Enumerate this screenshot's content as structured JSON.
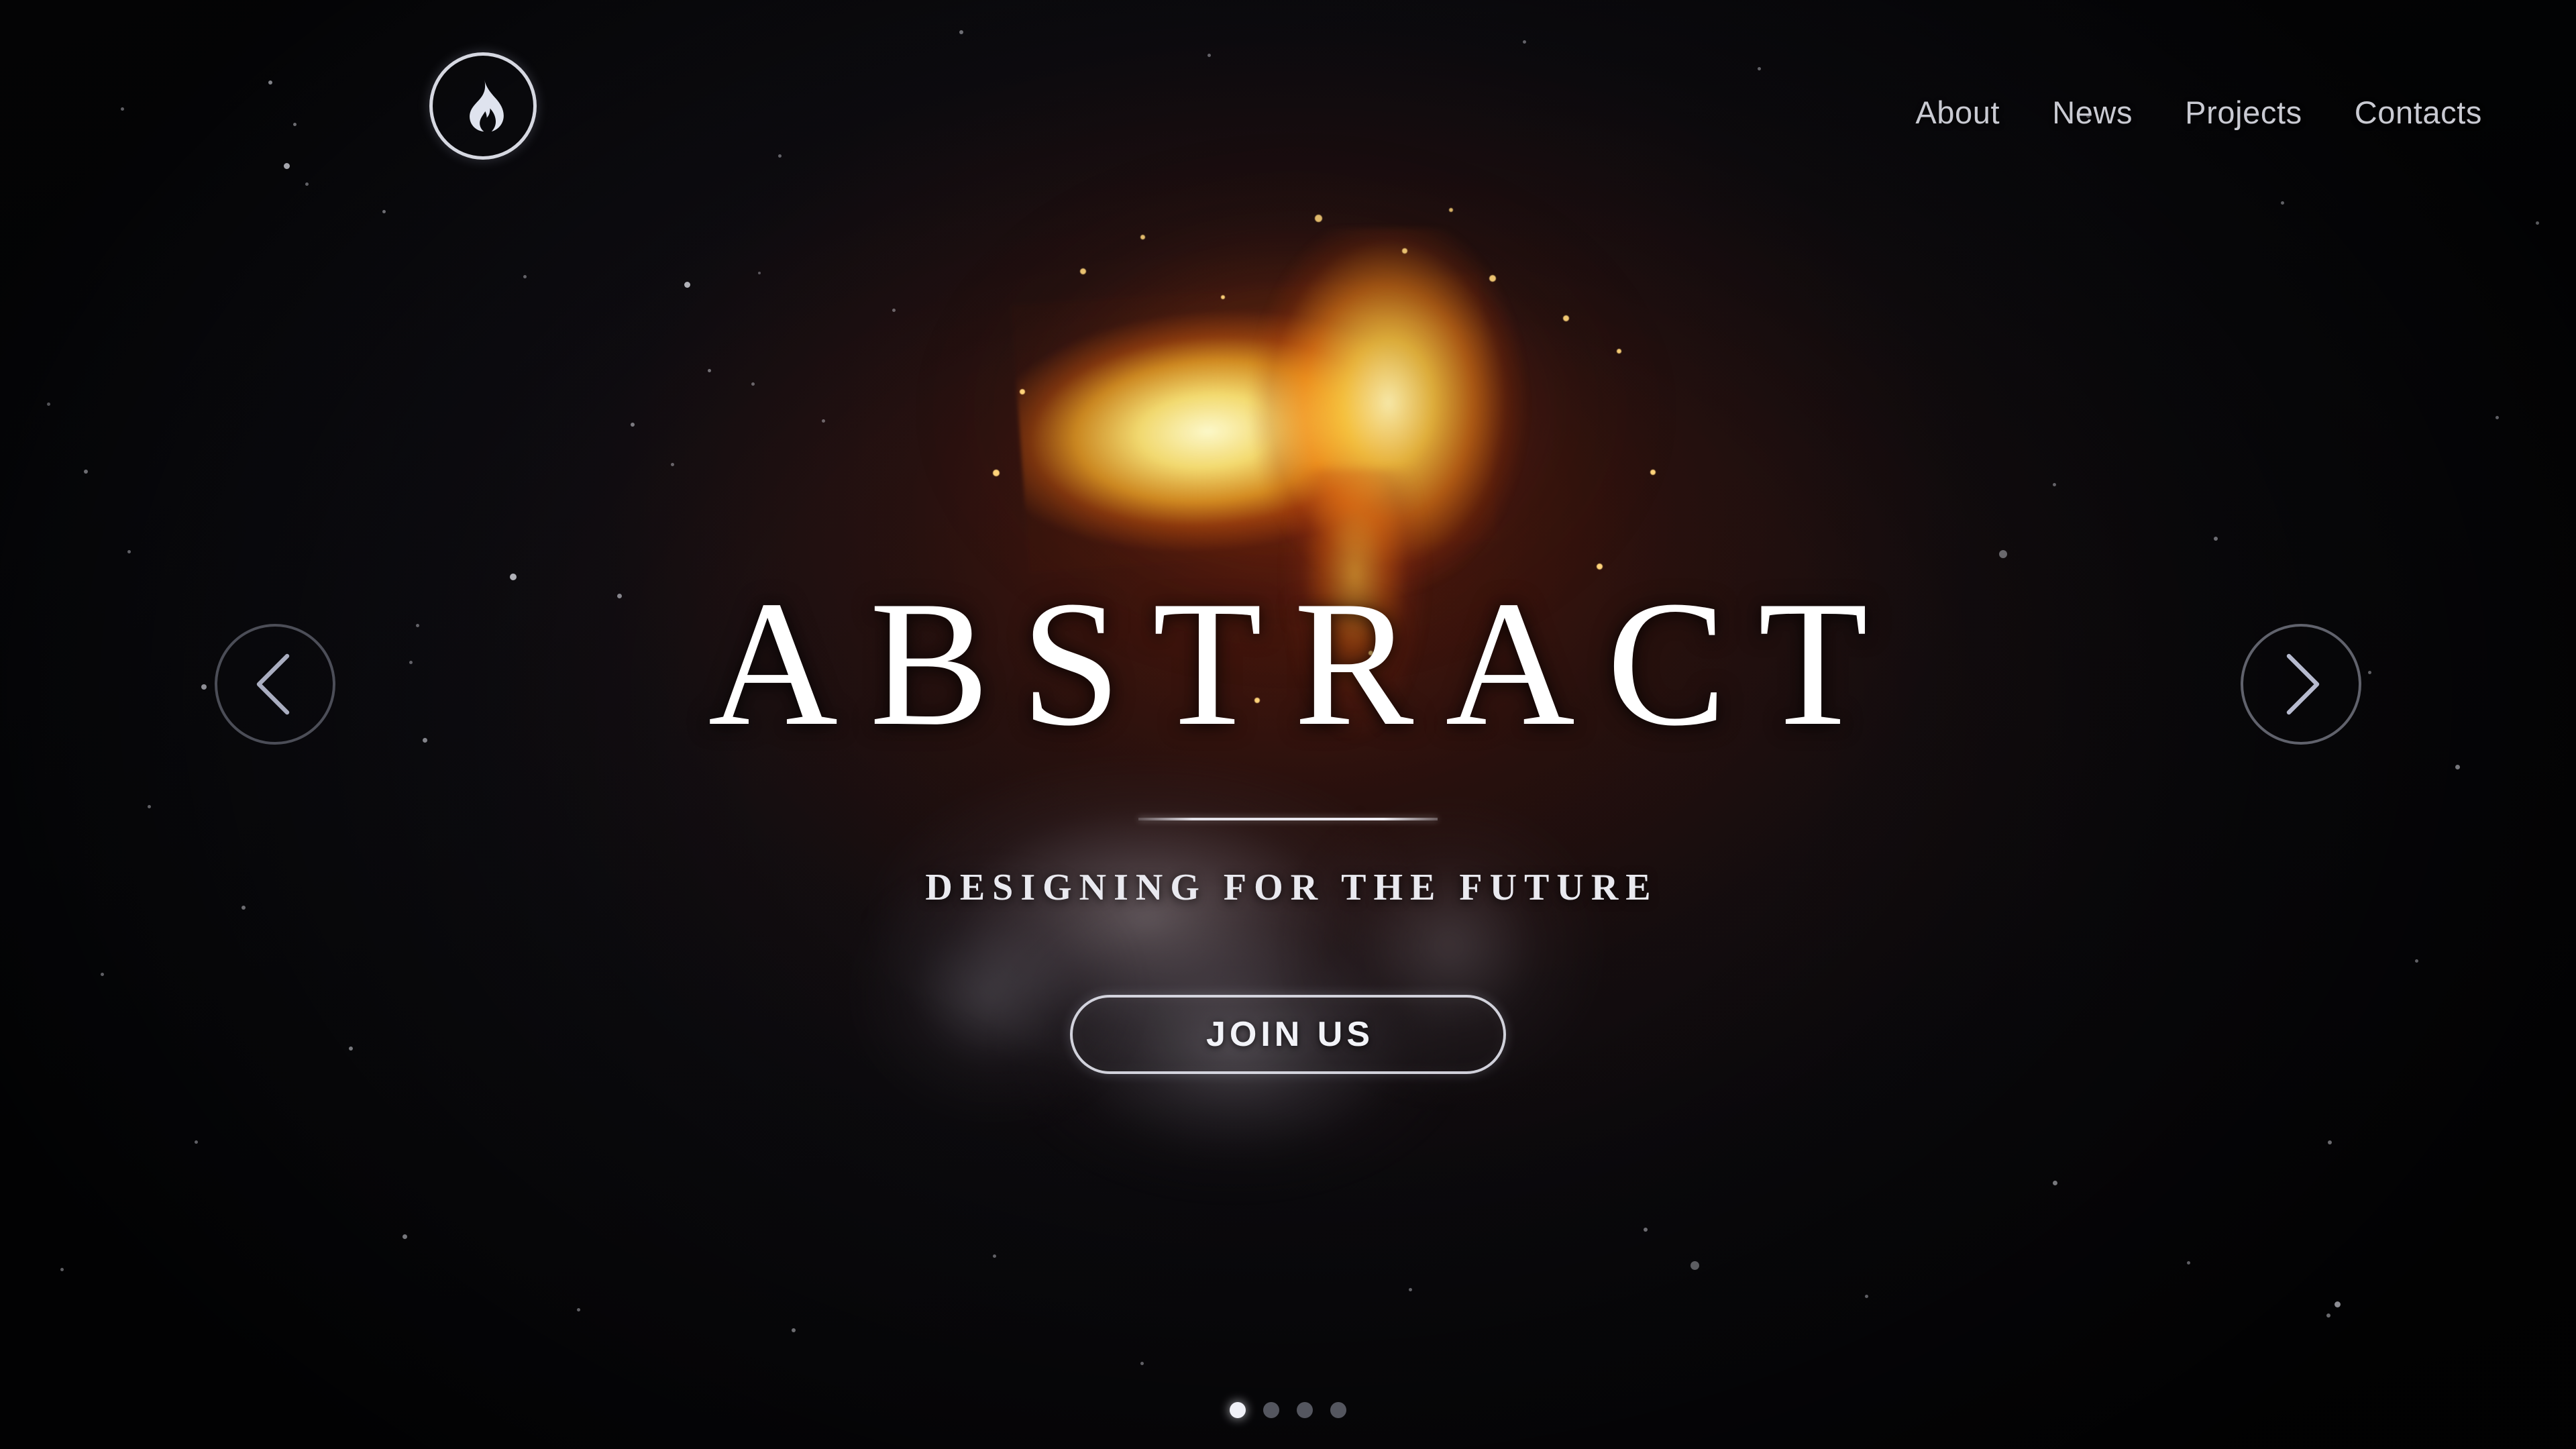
{
  "brand": {
    "logo_icon": "flame-icon",
    "logo_alt": "Flame logo"
  },
  "nav": {
    "items": [
      {
        "label": "About"
      },
      {
        "label": "News"
      },
      {
        "label": "Projects"
      },
      {
        "label": "Contacts"
      }
    ]
  },
  "hero": {
    "title": "ABSTRACT",
    "tagline": "DESIGNING FOR THE FUTURE",
    "cta_label": "JOIN US"
  },
  "carousel": {
    "prev_icon": "chevron-left-icon",
    "next_icon": "chevron-right-icon",
    "slide_count": 4,
    "active_slide": 1
  },
  "colors": {
    "background": "#0d0e13",
    "text_primary": "#ffffff",
    "text_secondary": "#c9cad2",
    "fire_bright": "#fff4b0",
    "fire_mid": "#ffb232",
    "fire_deep": "#ec6a0e",
    "smoke": "#d6d2de"
  }
}
